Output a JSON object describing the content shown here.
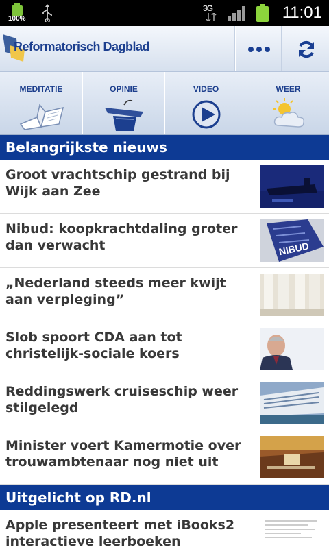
{
  "status_bar": {
    "battery_percent": "100%",
    "network": "3G",
    "time": "11:01"
  },
  "app_bar": {
    "title": "Reformatorisch Dagblad",
    "more_icon": "more-dots-icon",
    "refresh_icon": "refresh-icon",
    "brand_color": "#1a3f92"
  },
  "categories": [
    {
      "label": "MEDITATIE",
      "icon": "book-icon"
    },
    {
      "label": "OPINIE",
      "icon": "lectern-icon"
    },
    {
      "label": "VIDEO",
      "icon": "play-icon"
    },
    {
      "label": "WEER",
      "icon": "weather-icon"
    }
  ],
  "sections": [
    {
      "title": "Belangrijkste nieuws",
      "items": [
        {
          "title": "Groot vrachtschip gestrand bij Wijk aan Zee",
          "thumb": "ship-photo"
        },
        {
          "title": "Nibud: koopkrachtdaling groter dan verwacht",
          "thumb": "nibud-photo",
          "thumb_text": "NIBUD"
        },
        {
          "title": "„Nederland steeds meer kwijt aan verpleging”",
          "thumb": "nurses-photo"
        },
        {
          "title": "Slob spoort CDA aan tot christelijk-sociale koers",
          "thumb": "portrait-photo"
        },
        {
          "title": "Reddingswerk cruiseschip weer stilgelegd",
          "thumb": "cruise-ship-photo"
        },
        {
          "title": "Minister voert Kamermotie over trouwambtenaar nog niet uit",
          "thumb": "parliament-photo"
        }
      ]
    },
    {
      "title": "Uitgelicht op RD.nl",
      "items": [
        {
          "title": "Apple presenteert met iBooks2 interactieve leerboeken",
          "thumb": "document-photo"
        }
      ]
    }
  ],
  "colors": {
    "section_bg": "#0d3a94",
    "headline_text": "#383838"
  }
}
